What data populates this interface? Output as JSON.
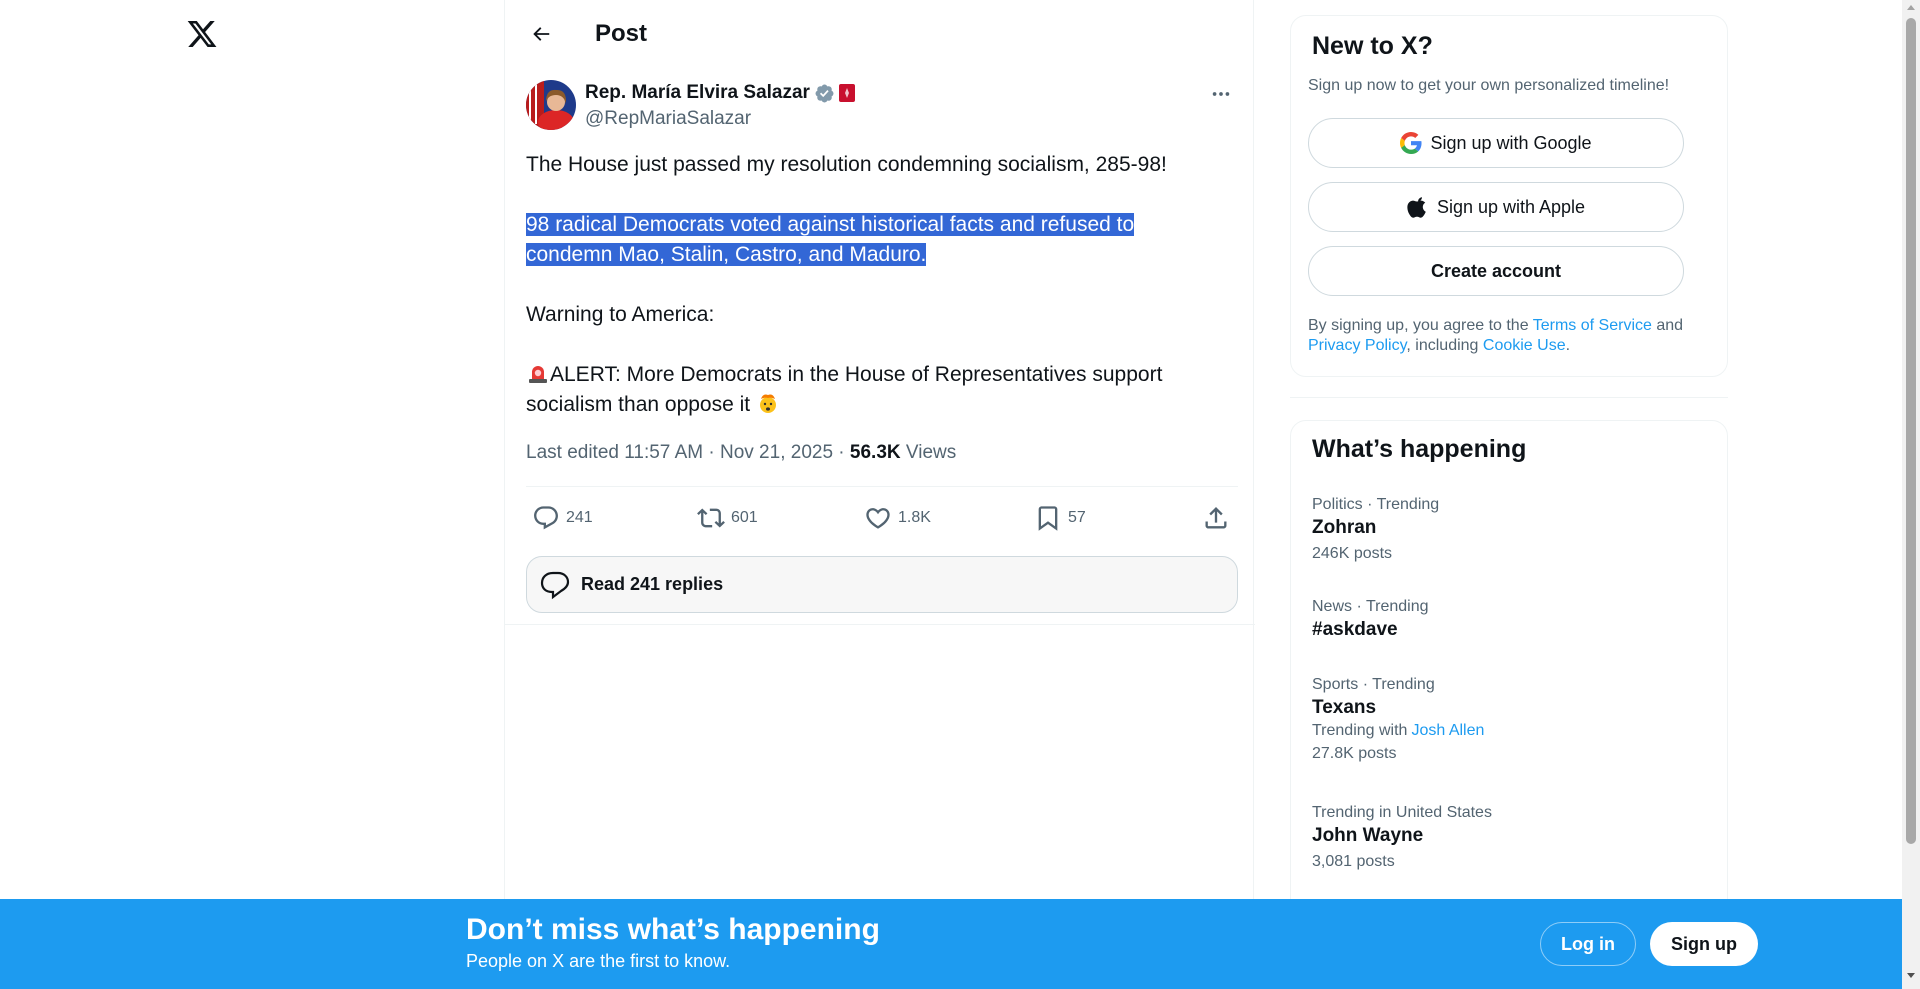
{
  "logo": {
    "icon": "x-logo-icon"
  },
  "header": {
    "title": "Post",
    "back_icon": "arrow-left-icon"
  },
  "post": {
    "author_name": "Rep. María Elvira Salazar",
    "author_handle": "@RepMariaSalazar",
    "paragraphs": [
      "The House just passed my resolution condemning socialism, 285-98!",
      "98 radical Democrats voted against historical facts and refused to",
      "condemn Mao, Stalin, Castro, and Maduro.",
      "Warning to America:",
      "ALERT: More Democrats in the House of Representatives support",
      "socialism than oppose it"
    ],
    "meta": {
      "edited": "Last edited 11:57 AM · Nov 21, 2025 · ",
      "views_count": "56.3K",
      "views_label": " Views"
    },
    "actions": {
      "replies": "241",
      "reposts": "601",
      "likes": "1.8K",
      "bookmarks": "57"
    },
    "read_replies": "Read 241 replies"
  },
  "signup": {
    "title": "New to X?",
    "subtitle": "Sign up now to get your own personalized timeline!",
    "google_label": "Sign up with Google",
    "apple_label": "Sign up with Apple",
    "create_label": "Create account",
    "legal_prefix": "By signing up, you agree to the ",
    "terms": "Terms of Service",
    "and": " and",
    "privacy": "Privacy Policy",
    "including": ", including ",
    "cookie": "Cookie Use",
    "period": "."
  },
  "trends": {
    "title": "What’s happening",
    "items": [
      {
        "category": "Politics · Trending",
        "name": "Zohran",
        "count": "246K posts"
      },
      {
        "category": "News · Trending",
        "name": "#askdave"
      },
      {
        "category": "Sports · Trending",
        "name": "Texans",
        "with_label": "Trending with",
        "with_link": "Josh Allen",
        "count": "27.8K posts"
      },
      {
        "category": "Trending in United States",
        "name": "John Wayne",
        "count": "3,081 posts"
      }
    ]
  },
  "banner": {
    "title": "Don’t miss what’s happening",
    "subtitle": "People on X are the first to know.",
    "login": "Log in",
    "signup": "Sign up"
  },
  "colors": {
    "accent": "#1d9bf0",
    "selection": "#3367d6",
    "muted_text": "#536471",
    "primary_text": "#0f1419"
  }
}
